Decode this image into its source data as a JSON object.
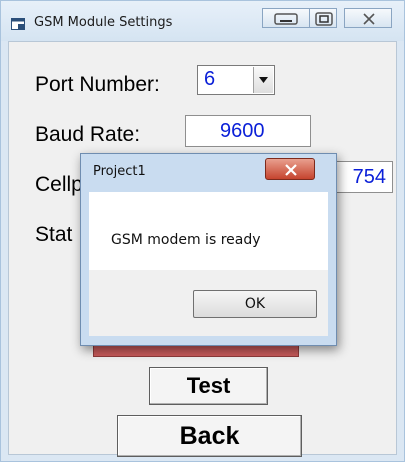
{
  "window": {
    "title": "GSM Module Settings",
    "icon": "app-window-icon",
    "controls": [
      "minimize-icon",
      "maximize-icon",
      "close-icon"
    ]
  },
  "form": {
    "port_label": "Port Number:",
    "port_value": "6",
    "baud_label": "Baud Rate:",
    "baud_value": "9600",
    "cellphone_label": "Cellp",
    "cellphone_value_tail": "754",
    "status_label": "Stat",
    "test_button": "Test",
    "back_button": "Back"
  },
  "dialog": {
    "title": "Project1",
    "message": "GSM modem is ready",
    "ok_button": "OK"
  },
  "colors": {
    "value_text": "#0a1fd8",
    "disconnect_bar": "#c85b5b",
    "dialog_close": "#c5442e"
  }
}
